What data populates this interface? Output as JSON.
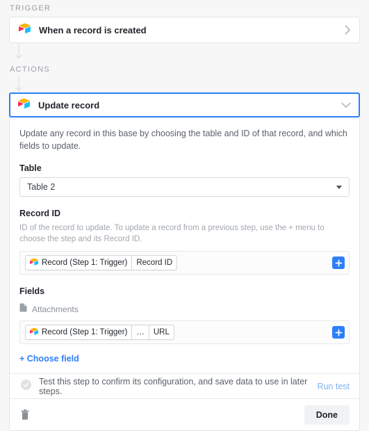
{
  "sections": {
    "trigger_label": "TRIGGER",
    "actions_label": "ACTIONS"
  },
  "trigger": {
    "icon": "airtable-icon",
    "title": "When a record is created",
    "chevron": "chevron-right-icon"
  },
  "action": {
    "icon": "airtable-icon",
    "title": "Update record",
    "chevron": "chevron-down-icon",
    "description": "Update any record in this base by choosing the table and ID of that record, and which fields to update.",
    "table": {
      "label": "Table",
      "value": "Table 2",
      "caret": "caret-down-icon"
    },
    "record_id": {
      "label": "Record ID",
      "hint": "ID of the record to update. To update a record from a previous step, use the + menu to choose the step and its Record ID.",
      "token": {
        "source": "Record (Step 1: Trigger)",
        "property": "Record ID"
      },
      "add_button": "plus-icon"
    },
    "fields": {
      "label": "Fields",
      "items": [
        {
          "icon": "file-icon",
          "name": "Attachments",
          "token": {
            "source": "Record (Step 1: Trigger)",
            "middle": "…",
            "property": "URL"
          },
          "add_button": "plus-icon"
        }
      ],
      "choose_field_label": "+ Choose field"
    },
    "test": {
      "status_icon": "check-circle-icon",
      "text": "Test this step to confirm its configuration, and save data to use in later steps.",
      "run_test_label": "Run test"
    },
    "footer": {
      "delete_icon": "trash-icon",
      "done_label": "Done"
    }
  },
  "colors": {
    "accent": "#2d7ff9",
    "page_bg": "#f7f7f7",
    "card_bg": "#ffffff",
    "muted_text": "#8b9096"
  }
}
